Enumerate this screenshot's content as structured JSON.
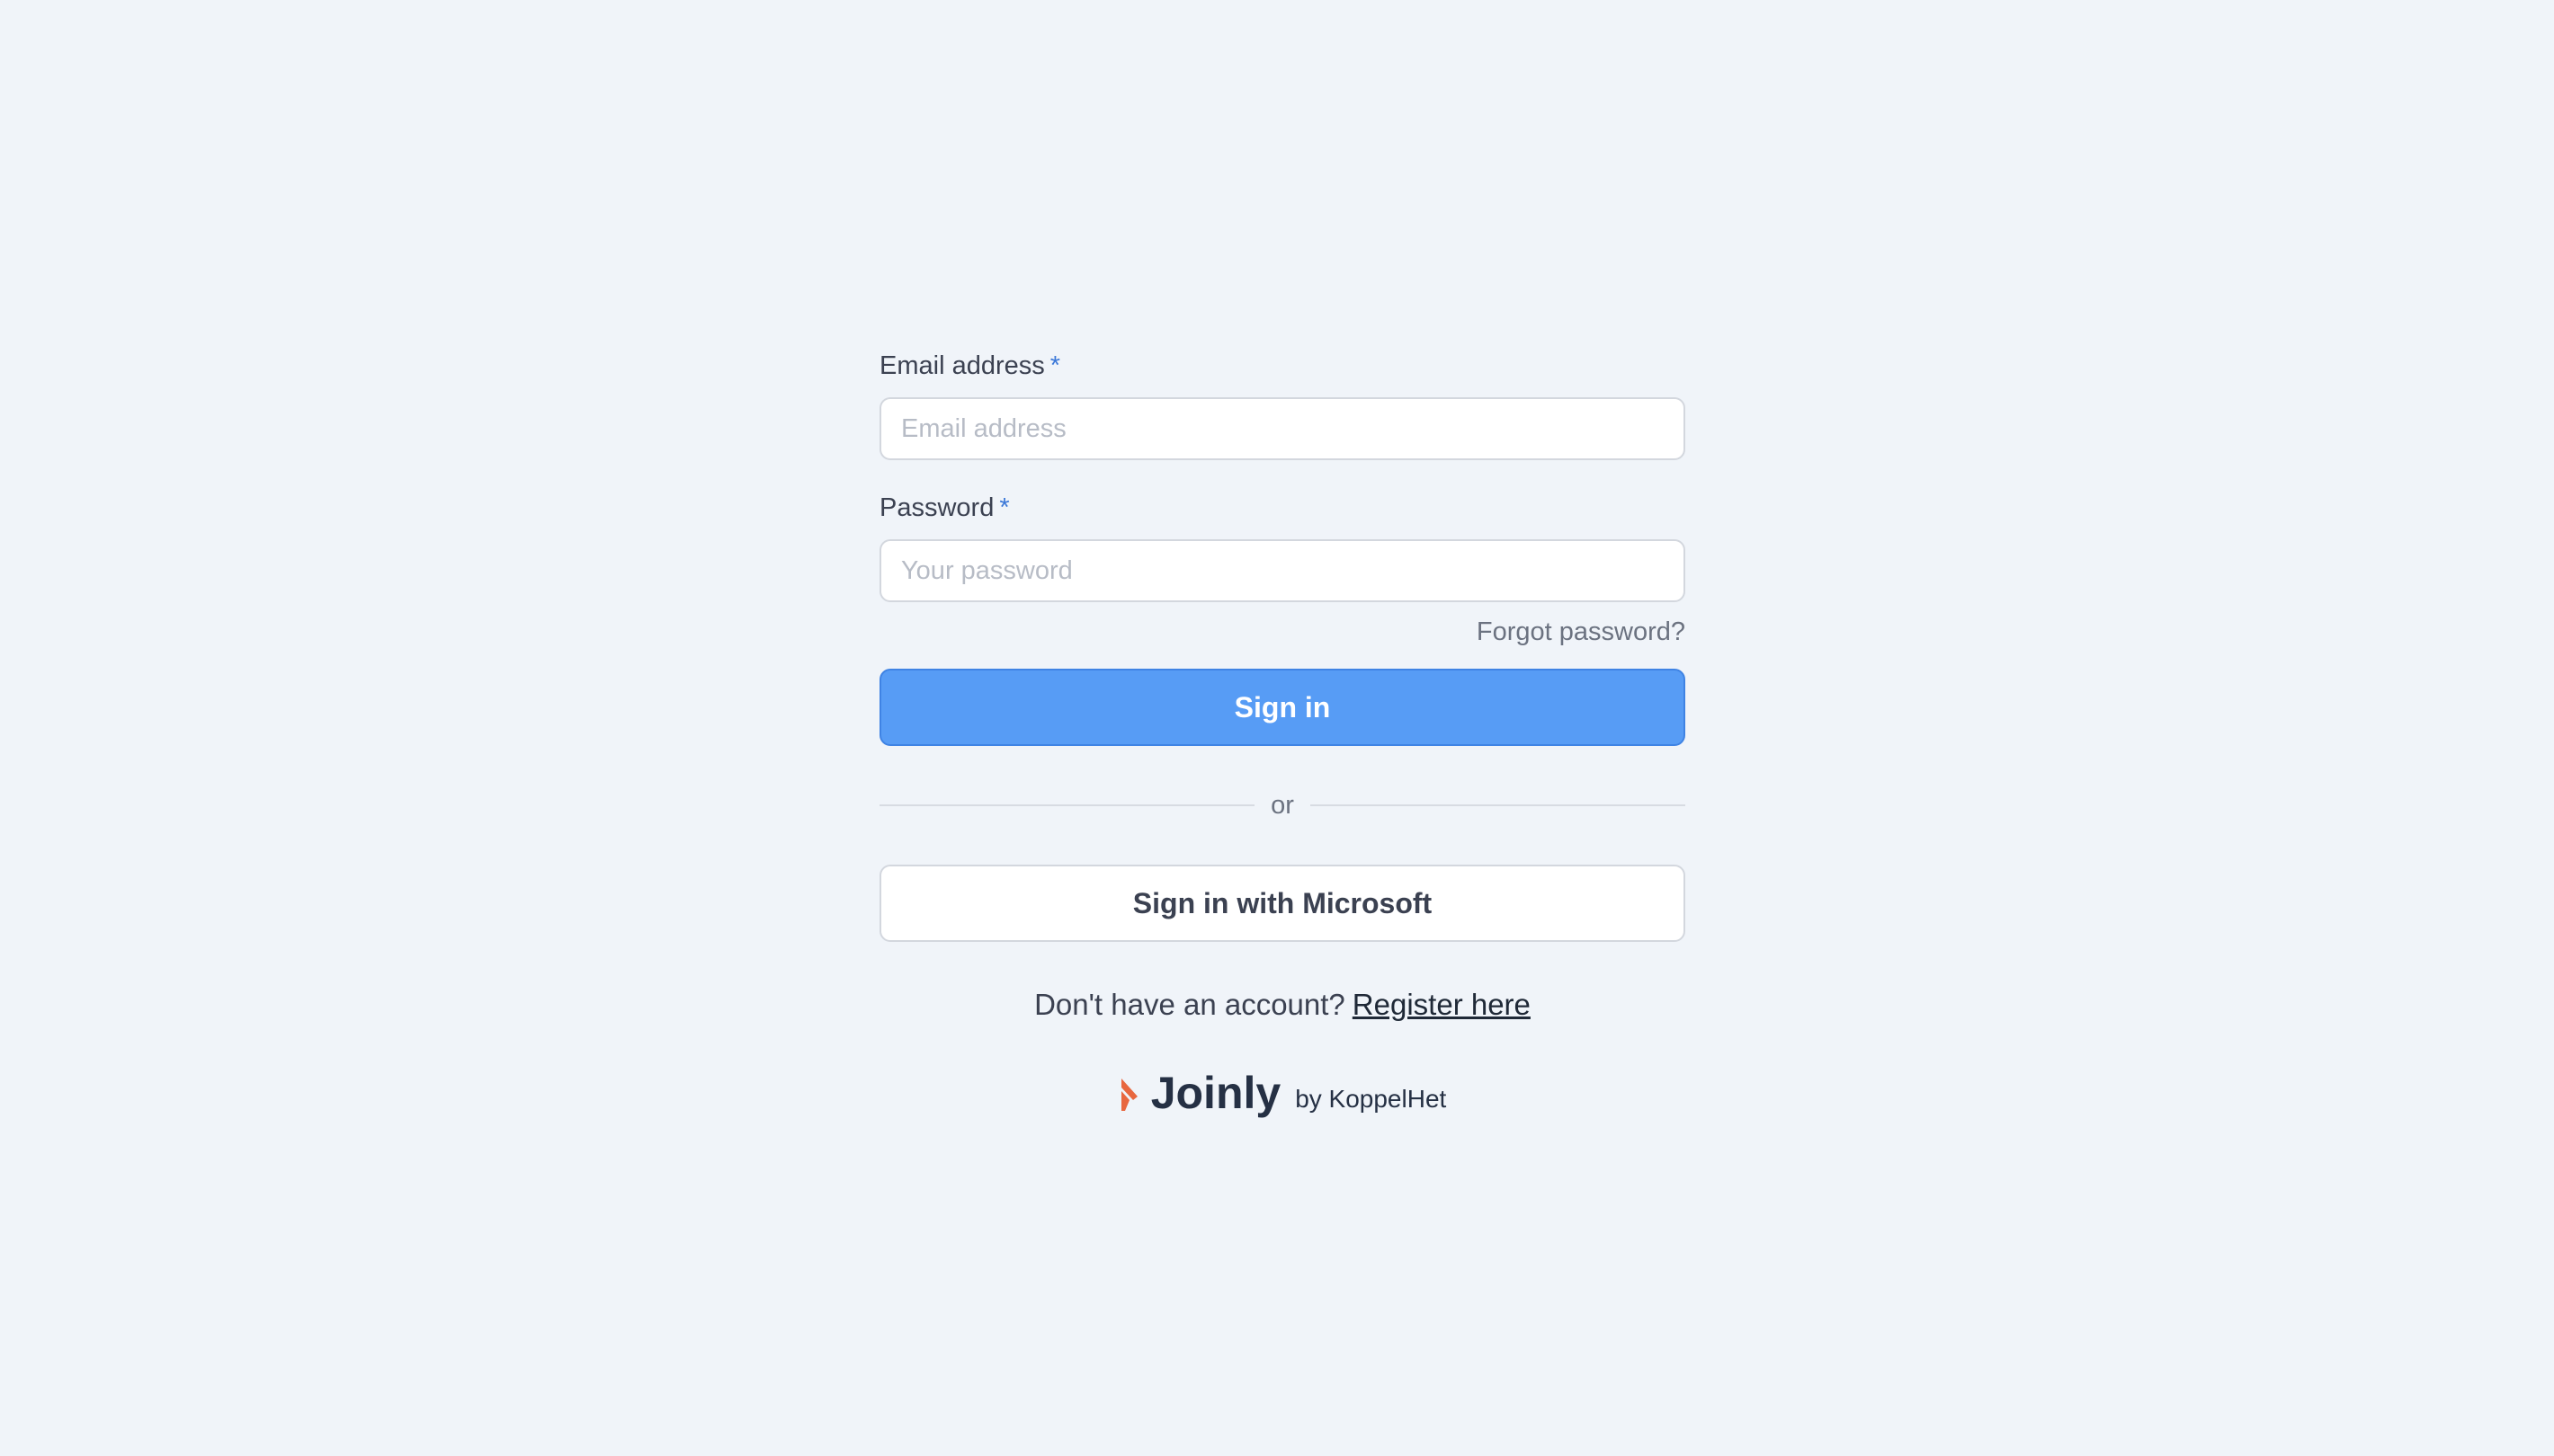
{
  "login_form": {
    "email": {
      "label": "Email address",
      "required_marker": "*",
      "placeholder": "Email address",
      "value": ""
    },
    "password": {
      "label": "Password",
      "required_marker": "*",
      "placeholder": "Your password",
      "value": ""
    },
    "forgot_password_label": "Forgot password?",
    "sign_in_label": "Sign in",
    "divider_text": "or",
    "microsoft_sign_in_label": "Sign in with Microsoft",
    "register_prompt": "Don't have an account?",
    "register_link_label": "Register here"
  },
  "branding": {
    "name": "Joinly",
    "byline": "by KoppelHet",
    "logo_icon": "joinly-logo-icon"
  },
  "colors": {
    "background": "#f0f4f9",
    "primary": "#579cf5",
    "required_marker": "#3b78d8",
    "logo_accent": "#e8673f"
  }
}
